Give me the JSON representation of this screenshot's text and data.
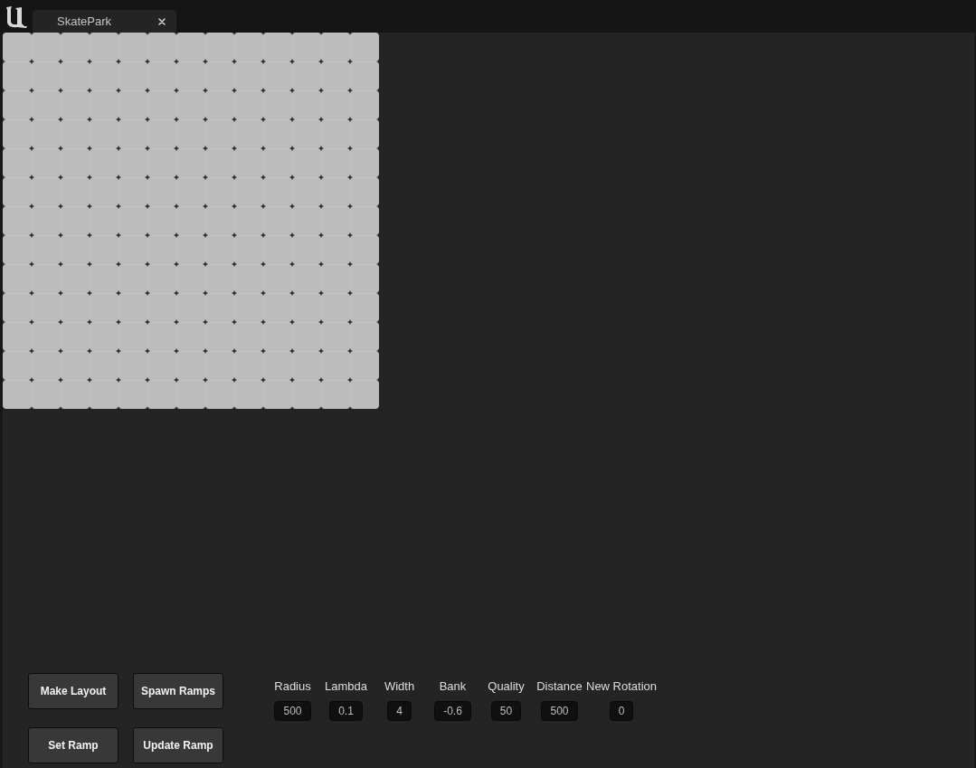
{
  "tabs": [
    {
      "label": "SkatePark",
      "selected": true
    }
  ],
  "buttons": [
    {
      "label": "Make Layout"
    },
    {
      "label": "Spawn Ramps"
    },
    {
      "label": "Set Ramp"
    },
    {
      "label": "Update Ramp"
    }
  ],
  "parameters": [
    {
      "label": "Radius",
      "value": "500"
    },
    {
      "label": "Lambda",
      "value": "0.1"
    },
    {
      "label": "Width",
      "value": "4"
    },
    {
      "label": "Bank",
      "value": "-0.6"
    },
    {
      "label": "Quality",
      "value": "50"
    },
    {
      "label": "Distance",
      "value": "500"
    },
    {
      "label": "New Rotation",
      "value": "0"
    }
  ]
}
